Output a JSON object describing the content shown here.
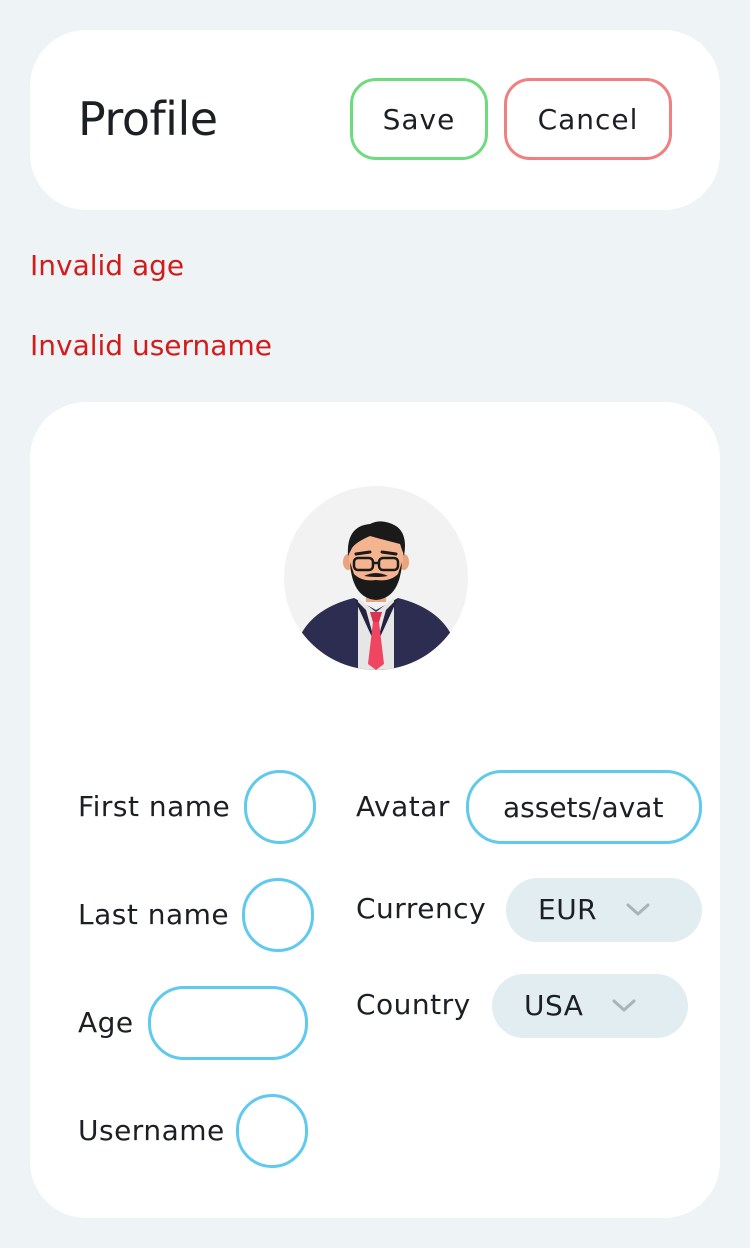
{
  "header": {
    "title": "Profile",
    "save_label": "Save",
    "cancel_label": "Cancel"
  },
  "errors": {
    "age": "Invalid age",
    "username": "Invalid username"
  },
  "form": {
    "first_name": {
      "label": "First name",
      "value": ""
    },
    "last_name": {
      "label": "Last name",
      "value": ""
    },
    "age": {
      "label": "Age",
      "value": ""
    },
    "username": {
      "label": "Username",
      "value": ""
    },
    "avatar": {
      "label": "Avatar",
      "value": "assets/avat"
    },
    "currency": {
      "label": "Currency",
      "value": "EUR"
    },
    "country": {
      "label": "Country",
      "value": "USA"
    }
  },
  "icons": {
    "avatar_image": "man-with-glasses-avatar",
    "dropdown": "chevron-down-icon"
  },
  "colors": {
    "background": "#eef3f6",
    "card": "#ffffff",
    "save_border": "#6ddb7e",
    "cancel_border": "#f07f7f",
    "error_text": "#d21c1c",
    "input_border": "#5fcaee",
    "select_bg": "#e1edf1"
  }
}
